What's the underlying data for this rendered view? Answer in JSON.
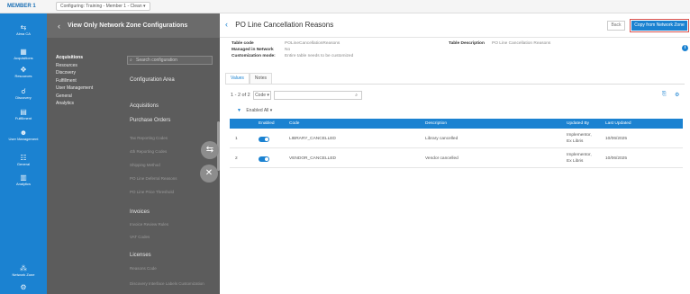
{
  "topbar": {
    "institution": "MEMBER 1",
    "config_label": "Configuring: Training - Member 1 - Clean ▾"
  },
  "rail": [
    {
      "label": "Alma CA",
      "icon": "alma-icon"
    },
    {
      "label": "Acquisitions",
      "icon": "acquisitions-icon"
    },
    {
      "label": "Resources",
      "icon": "resources-icon"
    },
    {
      "label": "Discovery",
      "icon": "discovery-icon"
    },
    {
      "label": "Fulfillment",
      "icon": "fulfillment-icon"
    },
    {
      "label": "User Management",
      "icon": "user-management-icon"
    },
    {
      "label": "General",
      "icon": "general-icon"
    },
    {
      "label": "Analytics",
      "icon": "analytics-icon"
    },
    {
      "label": "Network Zone",
      "icon": "network-zone-icon"
    }
  ],
  "overlay": {
    "title": "View Only Network Zone Configurations",
    "categories": [
      "Acquisitions",
      "Resources",
      "Discovery",
      "Fulfillment",
      "User Management",
      "General",
      "Analytics"
    ],
    "search_placeholder": "Search configuration",
    "area_title": "Configuration Area",
    "group1": "Acquisitions",
    "group2": "Purchase Orders",
    "po_items": [
      "Tax Reporting Codes",
      "4th Reporting Codes",
      "Shipping Method",
      "PO Line Deferral Reasons",
      "PO Line Price Threshold"
    ],
    "group3": "Invoices",
    "invoice_items": [
      "Invoice Review Rules",
      "VAT Codes"
    ],
    "group4": "Licenses",
    "license_items": [
      "Reasons Code",
      "Discovery Interface Labels Customization"
    ]
  },
  "main": {
    "title": "PO Line Cancellation Reasons",
    "back_button": "Back",
    "copy_button": "Copy from Network Zone",
    "meta": {
      "table_code_label": "Table code",
      "table_code_value": "POLineCancellationReasons",
      "managed_label": "Managed in Network",
      "managed_value": "No",
      "customization_label": "Customization mode:",
      "customization_value": "Entire table needs to be customized",
      "description_label": "Table Description",
      "description_value": "PO Line Cancellation Reasons"
    },
    "tabs": [
      "Values",
      "Notes"
    ],
    "count": "1 - 2 of 2",
    "code_dropdown": "Code ▾",
    "filter_label": "Enabled",
    "filter_value": "All",
    "columns": [
      "Enabled",
      "Code",
      "Description",
      "Updated By",
      "Last Updated"
    ],
    "rows": [
      {
        "num": "1",
        "code": "LIBRARY_CANCELLED",
        "description": "Library cancelled",
        "updated_by_1": "Implementor,",
        "updated_by_2": "Ex Libris",
        "last_updated": "10/06/2025"
      },
      {
        "num": "2",
        "code": "VENDOR_CANCELLED",
        "description": "Vendor cancelled",
        "updated_by_1": "Implementor,",
        "updated_by_2": "Ex Libris",
        "last_updated": "10/06/2025"
      }
    ]
  }
}
